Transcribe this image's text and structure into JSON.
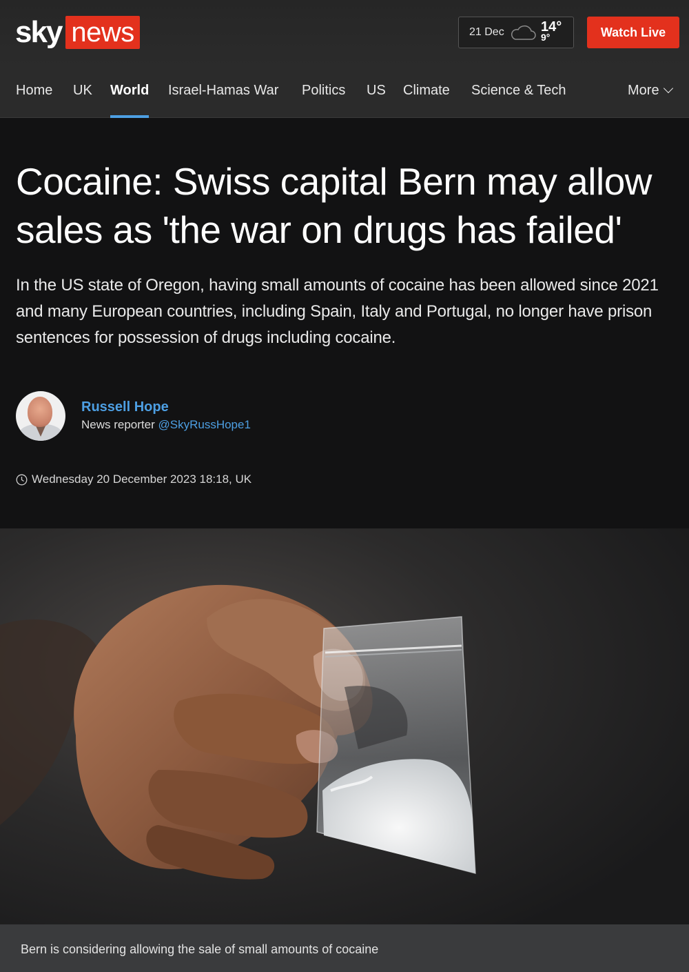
{
  "brand": {
    "logo_sky": "sky",
    "logo_news": "news",
    "accent_red": "#e3311d",
    "accent_blue": "#4d9fe3"
  },
  "weather": {
    "date": "21 Dec",
    "icon": "cloud-icon",
    "high": "14°",
    "low": "9°"
  },
  "watch_live": "Watch Live",
  "nav": {
    "items": [
      {
        "label": "Home"
      },
      {
        "label": "UK"
      },
      {
        "label": "World",
        "active": true
      },
      {
        "label": "Israel-Hamas War"
      },
      {
        "label": "Politics"
      },
      {
        "label": "US"
      },
      {
        "label": "Climate"
      },
      {
        "label": "Science & Tech"
      }
    ],
    "more": "More"
  },
  "article": {
    "headline": "Cocaine: Swiss capital Bern may allow sales as 'the war on drugs has failed'",
    "standfirst": "In the US state of Oregon, having small amounts of cocaine has been allowed since 2021 and many European countries, including Spain, Italy and Portugal, no longer have prison sentences for possession of drugs including cocaine.",
    "author": {
      "name": "Russell Hope",
      "role": "News reporter",
      "handle": "@SkyRussHope1"
    },
    "timestamp": "Wednesday 20 December 2023 18:18, UK",
    "image_caption": "Bern is considering allowing the sale of small amounts of cocaine"
  }
}
